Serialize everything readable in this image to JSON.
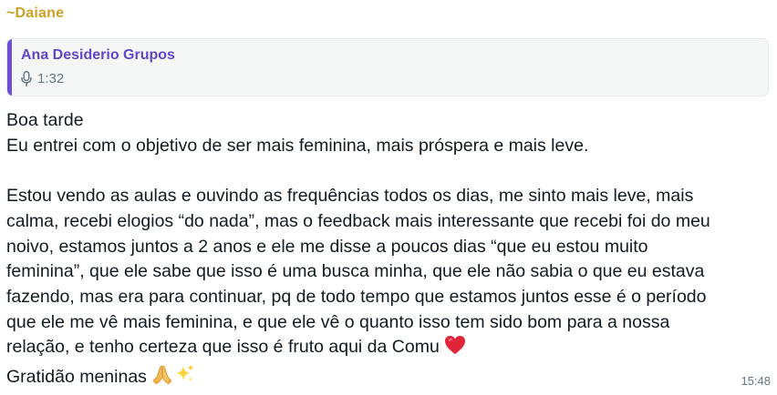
{
  "message": {
    "sender": "~Daiane",
    "quoted": {
      "author": "Ana Desiderio Grupos",
      "audio_duration": "1:32",
      "icon": "microphone-icon"
    },
    "lines": {
      "l1": "Boa tarde",
      "l2": "Eu entrei com o objetivo de ser mais feminina, mais próspera e mais leve.",
      "l3": "Estou vendo as aulas e ouvindo as frequências todos os dias, me sinto mais leve, mais",
      "l4": "calma, recebi elogios “do nada”, mas o feedback mais interessante que recebi foi do meu",
      "l5": "noivo, estamos juntos a 2 anos e ele me disse a poucos dias “que eu estou muito",
      "l6": "feminina”, que ele sabe que isso é uma busca minha, que ele não sabia o que eu estava",
      "l7": "fazendo, mas era para continuar, pq de todo tempo que estamos juntos esse é o período",
      "l8": "que ele me vê mais feminina, e que ele vê o quanto isso tem sido bom para a nossa",
      "l9": "relação, e tenho certeza que isso é fruto aqui da Comu",
      "l10": "Gratidão meninas"
    },
    "emojis": [
      "red-heart",
      "folded-hands",
      "sparkles"
    ],
    "time": "15:48"
  },
  "colors": {
    "sender": "#c9a227",
    "quote_bar": "#6f4fd6",
    "quote_author": "#6246c9",
    "meta": "#667781"
  }
}
